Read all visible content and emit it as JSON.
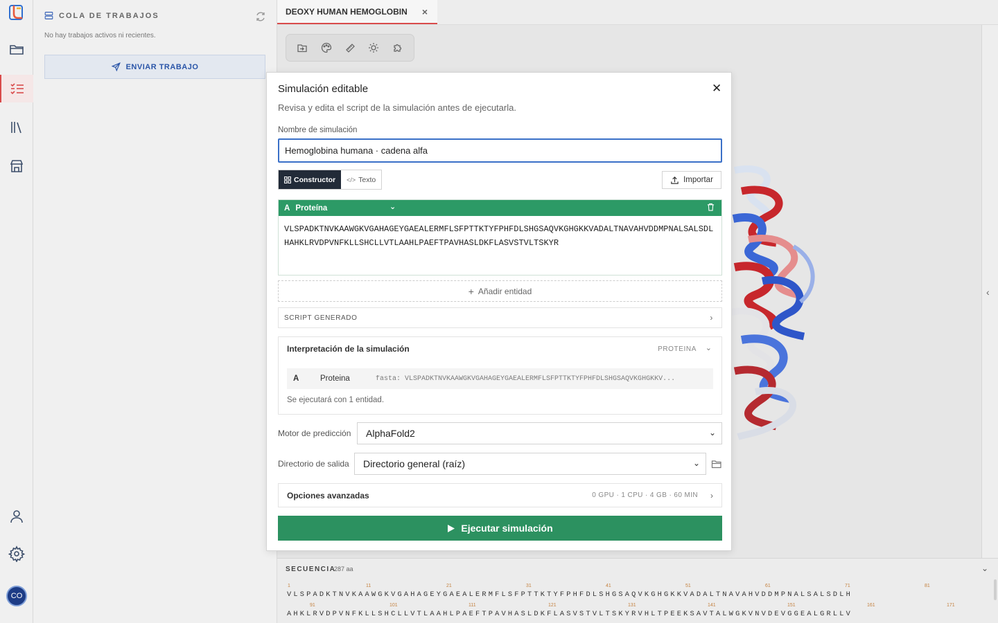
{
  "queue": {
    "title": "COLA DE TRABAJOS",
    "empty_message": "No hay trabajos activos ni recientes.",
    "send_button": "ENVIAR TRABAJO"
  },
  "user": {
    "initials": "CO"
  },
  "tab": {
    "label": "DEOXY HUMAN HEMOGLOBIN",
    "close": "×"
  },
  "modal": {
    "title": "Simulación editable",
    "close": "✕",
    "subtitle": "Revisa y edita el script de la simulación antes de ejecutarla.",
    "name_label": "Nombre de simulación",
    "name_value": "Hemoglobina humana · cadena alfa",
    "mode_builder": "Constructor",
    "mode_text": "Texto",
    "import_label": "Importar",
    "entity": {
      "chain": "A",
      "type": "Proteína",
      "sequence": "VLSPADKTNVKAAWGKVGAHAGEYGAEALERMFLSFPTTKTYFPHFDLSHGSAQVKGHGKKVADALTNAVAHVDDMPNALSALSDLHAHKLRVDPVNFKLLSHCLLVTLAAHLPAEFTPAVHASLDKFLASVSTVLTSKYR"
    },
    "add_entity": "Añadir entidad",
    "script_label": "SCRIPT GENERADO",
    "interpretation": {
      "title": "Interpretación de la simulación",
      "tag": "PROTEINA",
      "chain": "A",
      "type": "Proteina",
      "fasta": "fasta: VLSPADKTNVKAAWGKVGAHAGEYGAEALERMFLSFPTTKTYFPHFDLSHGSAQVKGHGKKV...",
      "note": "Se ejecutará con 1 entidad."
    },
    "engine_label": "Motor de predicción",
    "engine_value": "AlphaFold2",
    "output_label": "Directorio de salida",
    "output_value": "Directorio general (raíz)",
    "advanced_title": "Opciones avanzadas",
    "advanced_info": "0 GPU · 1 CPU · 4 GB · 60 MIN",
    "run_label": "Ejecutar simulación"
  },
  "sequence_panel": {
    "title": "SECUENCIA",
    "count": "287 aa",
    "row1_numbers": [
      "1",
      "11",
      "21",
      "31",
      "41",
      "51",
      "61",
      "71",
      "81"
    ],
    "row1_residues": "VLSPADKTNVKAAWGKVGAHAGEYGAEALERMFLSFPTTKTYFPHFDLSHGSAQVKGHGKKVADALTNAVAHVDDMPNALSALSDLH",
    "row2_numbers": [
      "91",
      "101",
      "111",
      "121",
      "131",
      "141",
      "151",
      "161",
      "171"
    ],
    "row2_residues": "AHKLRVDPVNFKLLSHCLLVTLAAHLPAEFTPAVHASLDKFLASVSTVLTSKYRVHLTPEEKSAVTALWGKVNVDEVGGEALGRLLV"
  },
  "colors": {
    "accent_red": "#d94b4b",
    "run_green": "#2c9160",
    "entity_green": "#2c9a66",
    "link_blue": "#2a55a8",
    "avatar_blue": "#1d3c86"
  },
  "icons": {
    "rail": [
      "folder-icon",
      "task-list-icon",
      "library-icon",
      "store-icon",
      "user-icon",
      "settings-icon"
    ],
    "toolbar": [
      "export-icon",
      "palette-icon",
      "measure-icon",
      "lighting-icon",
      "puzzle-icon"
    ]
  }
}
